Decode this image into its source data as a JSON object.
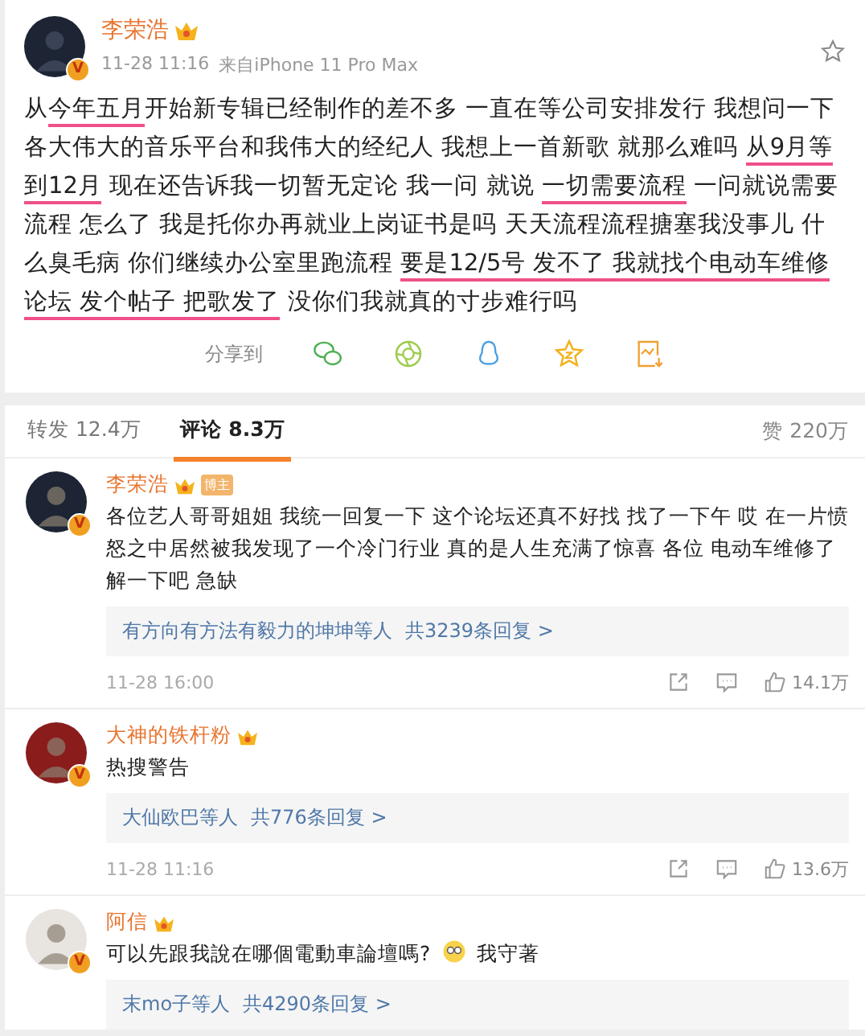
{
  "post": {
    "author": "李荣浩",
    "verified_badge": "V",
    "time": "11-28 11:16",
    "source": "来自iPhone 11 Pro Max",
    "segments": [
      {
        "text": "从",
        "marked": false
      },
      {
        "text": "今年五月",
        "marked": true
      },
      {
        "text": "开始新专辑已经制作的差不多 一直在等公司安排发行 我想问一下各大伟大的音乐平台和我伟大的经纪人 我想上一首新歌 就那么难吗 ",
        "marked": false
      },
      {
        "text": "从9月等到12月",
        "marked": true
      },
      {
        "text": " 现在还告诉我一切暂无定论 我一问 就说 ",
        "marked": false
      },
      {
        "text": "一切需要流程",
        "marked": true
      },
      {
        "text": " 一问就说需要流程 怎么了 我是托你办再就业上岗证书是吗 天天流程流程搪塞我没事儿 什么臭毛病 你们继续办公室里跑流程 ",
        "marked": false
      },
      {
        "text": "要是12/5号 发不了 我就找个电动车维修论坛 发个帖子 把歌发了",
        "marked": true
      },
      {
        "text": " 没你们我就真的寸步难行吗",
        "marked": false
      }
    ],
    "share_label": "分享到"
  },
  "tabs": [
    {
      "label": "转发 12.4万",
      "selected": false
    },
    {
      "label": "评论 8.3万",
      "selected": true
    }
  ],
  "likes_total": "赞 220万",
  "comments": [
    {
      "name": "李荣浩",
      "color": "#1d2433",
      "verified_badge": "V",
      "tag": "博主",
      "parts": [
        {
          "kind": "text",
          "text": "各位艺人哥哥姐姐 我统一回复一下 这个论坛还真不好找 找了一下午 哎 在一片愤怒之中居然被我发现了一个冷门行业  真的是人生充满了惊喜 各位 电动车维修了解一下吧 急缺"
        }
      ],
      "reply_names": "有方向有方法有毅力的坤坤等人",
      "reply_count": "共3239条回复 >",
      "time": "11-28 16:00",
      "likes": "14.1万"
    },
    {
      "name": "大神的铁杆粉",
      "color": "#8a1c1c",
      "verified_badge": "V",
      "parts": [
        {
          "kind": "text",
          "text": "热搜警告"
        }
      ],
      "reply_names": "大仙欧巴等人",
      "reply_count": "共776条回复 >",
      "time": "11-28 11:16",
      "likes": "13.6万"
    },
    {
      "name": "阿信",
      "color": "#e8e4e0",
      "verified_badge": "V",
      "parts": [
        {
          "kind": "text",
          "text": "可以先跟我說在哪個電動車論壇嗎? "
        },
        {
          "kind": "emoji"
        },
        {
          "kind": "text",
          "text": " 我守著"
        }
      ],
      "reply_names": "末mo子等人",
      "reply_count": "共4290条回复 >"
    }
  ]
}
